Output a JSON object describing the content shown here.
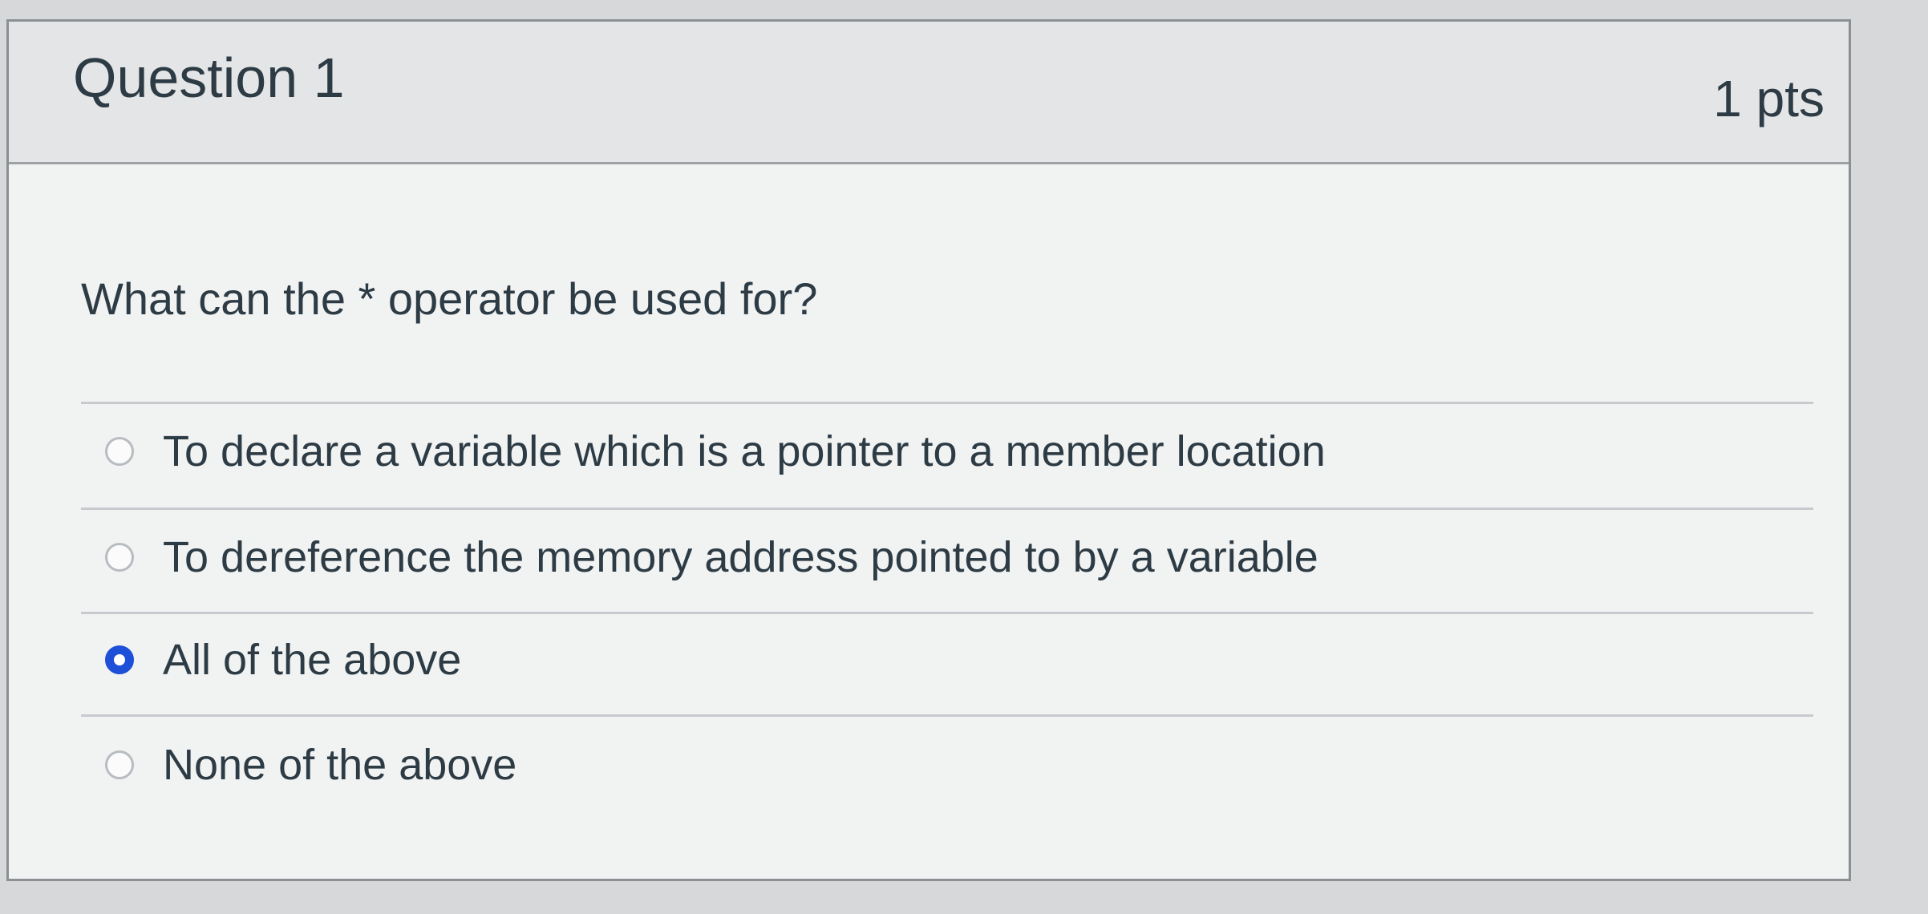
{
  "question": {
    "title": "Question 1",
    "points": "1 pts",
    "text": "What can the * operator be used for?"
  },
  "answers": [
    {
      "label": "To declare a variable which is a pointer to a member location",
      "selected": false
    },
    {
      "label": "To dereference the memory address pointed to by a variable",
      "selected": false
    },
    {
      "label": "All of the above",
      "selected": true
    },
    {
      "label": "None of the above",
      "selected": false
    }
  ],
  "colors": {
    "selected_radio": "#1d4fd8",
    "header_background": "#e4e5e6",
    "card_background": "#f1f2f2"
  }
}
